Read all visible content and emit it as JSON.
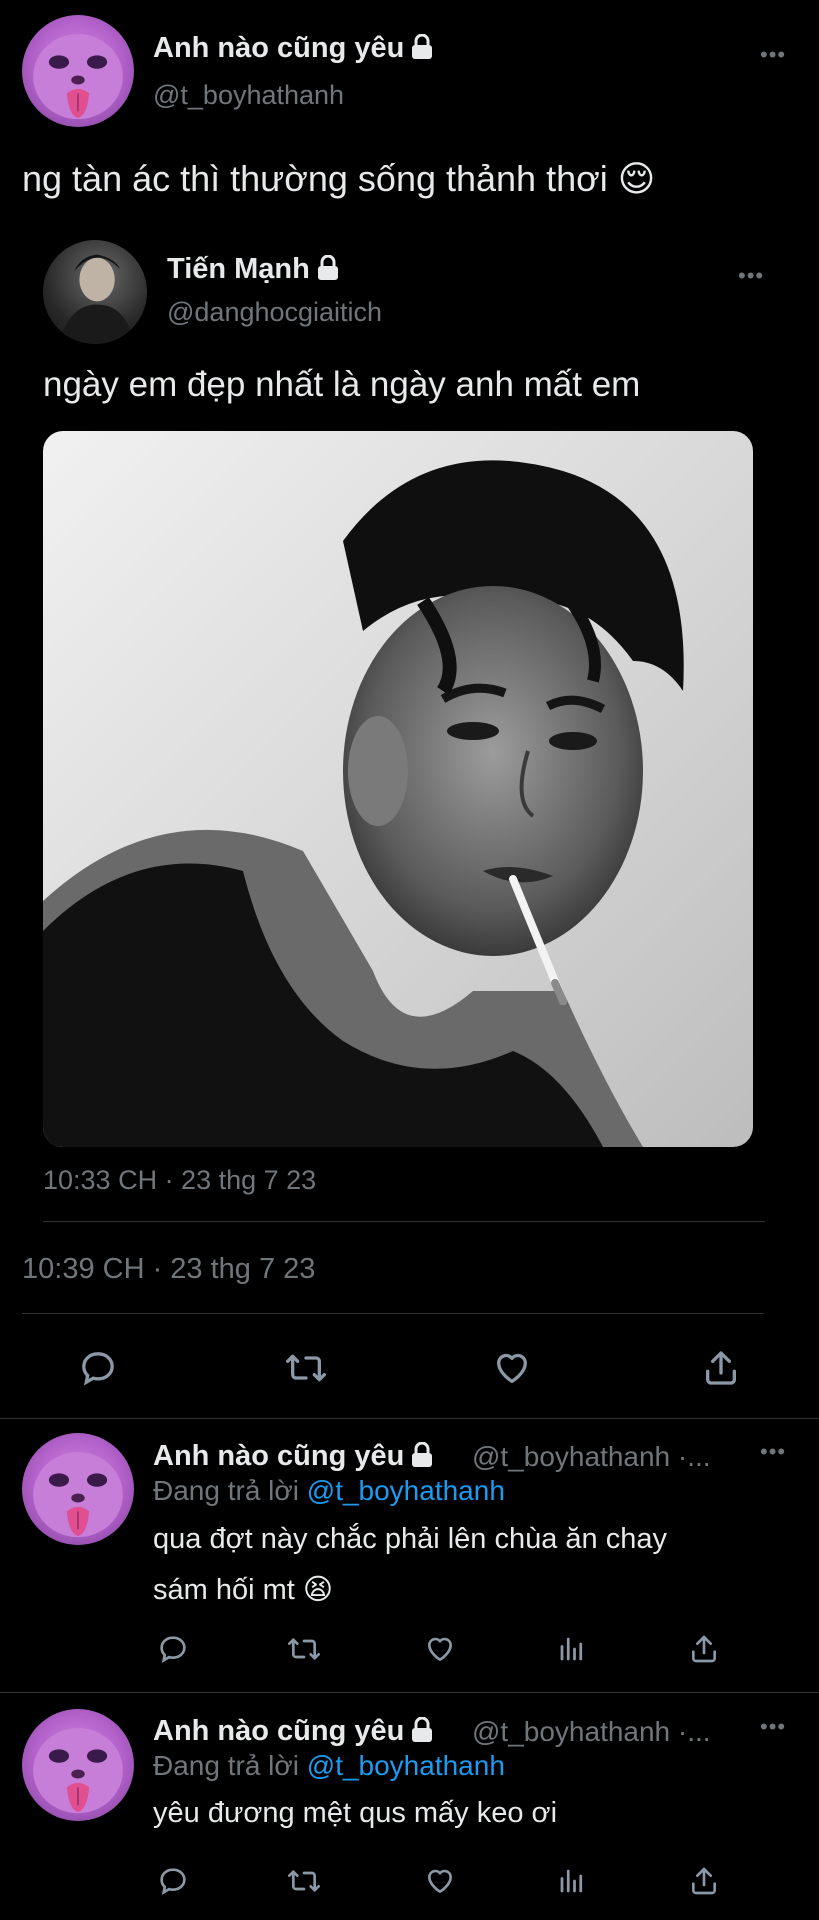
{
  "main_tweet": {
    "name": "Anh nào cũng yêu",
    "handle": "@t_boyhathanh",
    "text": "ng tàn ác thì thường sống thảnh thơi 😌",
    "more": "•••",
    "timestamp": "10:39 CH · 23 thg 7 23"
  },
  "quoted_tweet": {
    "name": "Tiến Mạnh",
    "handle": "@danghocgiaitich",
    "text": "ngày em đẹp nhất là ngày anh mất em",
    "more": "•••",
    "timestamp": "10:33 CH · 23 thg 7 23"
  },
  "actions": [
    "reply-icon",
    "retweet-icon",
    "like-icon",
    "share-icon"
  ],
  "replies": [
    {
      "name": "Anh nào cũng yêu",
      "handle": "@t_boyhathanh ·...",
      "more": "•••",
      "replying_prefix": "Đang trả lời",
      "replying_to": "@t_boyhathanh",
      "text_line1": "qua đợt này chắc phải lên chùa ăn chay",
      "text_line2": "sám hối mt 😫"
    },
    {
      "name": "Anh nào cũng yêu",
      "handle": "@t_boyhathanh ·...",
      "more": "•••",
      "replying_prefix": "Đang trả lời",
      "replying_to": "@t_boyhathanh",
      "text_line1": "yêu đương mệt qus mấy keo ơi"
    }
  ],
  "colors": {
    "background": "#000000",
    "text": "#e7e9ea",
    "secondary": "#71767b",
    "link": "#1d9bf0",
    "divider": "#2f3336"
  }
}
